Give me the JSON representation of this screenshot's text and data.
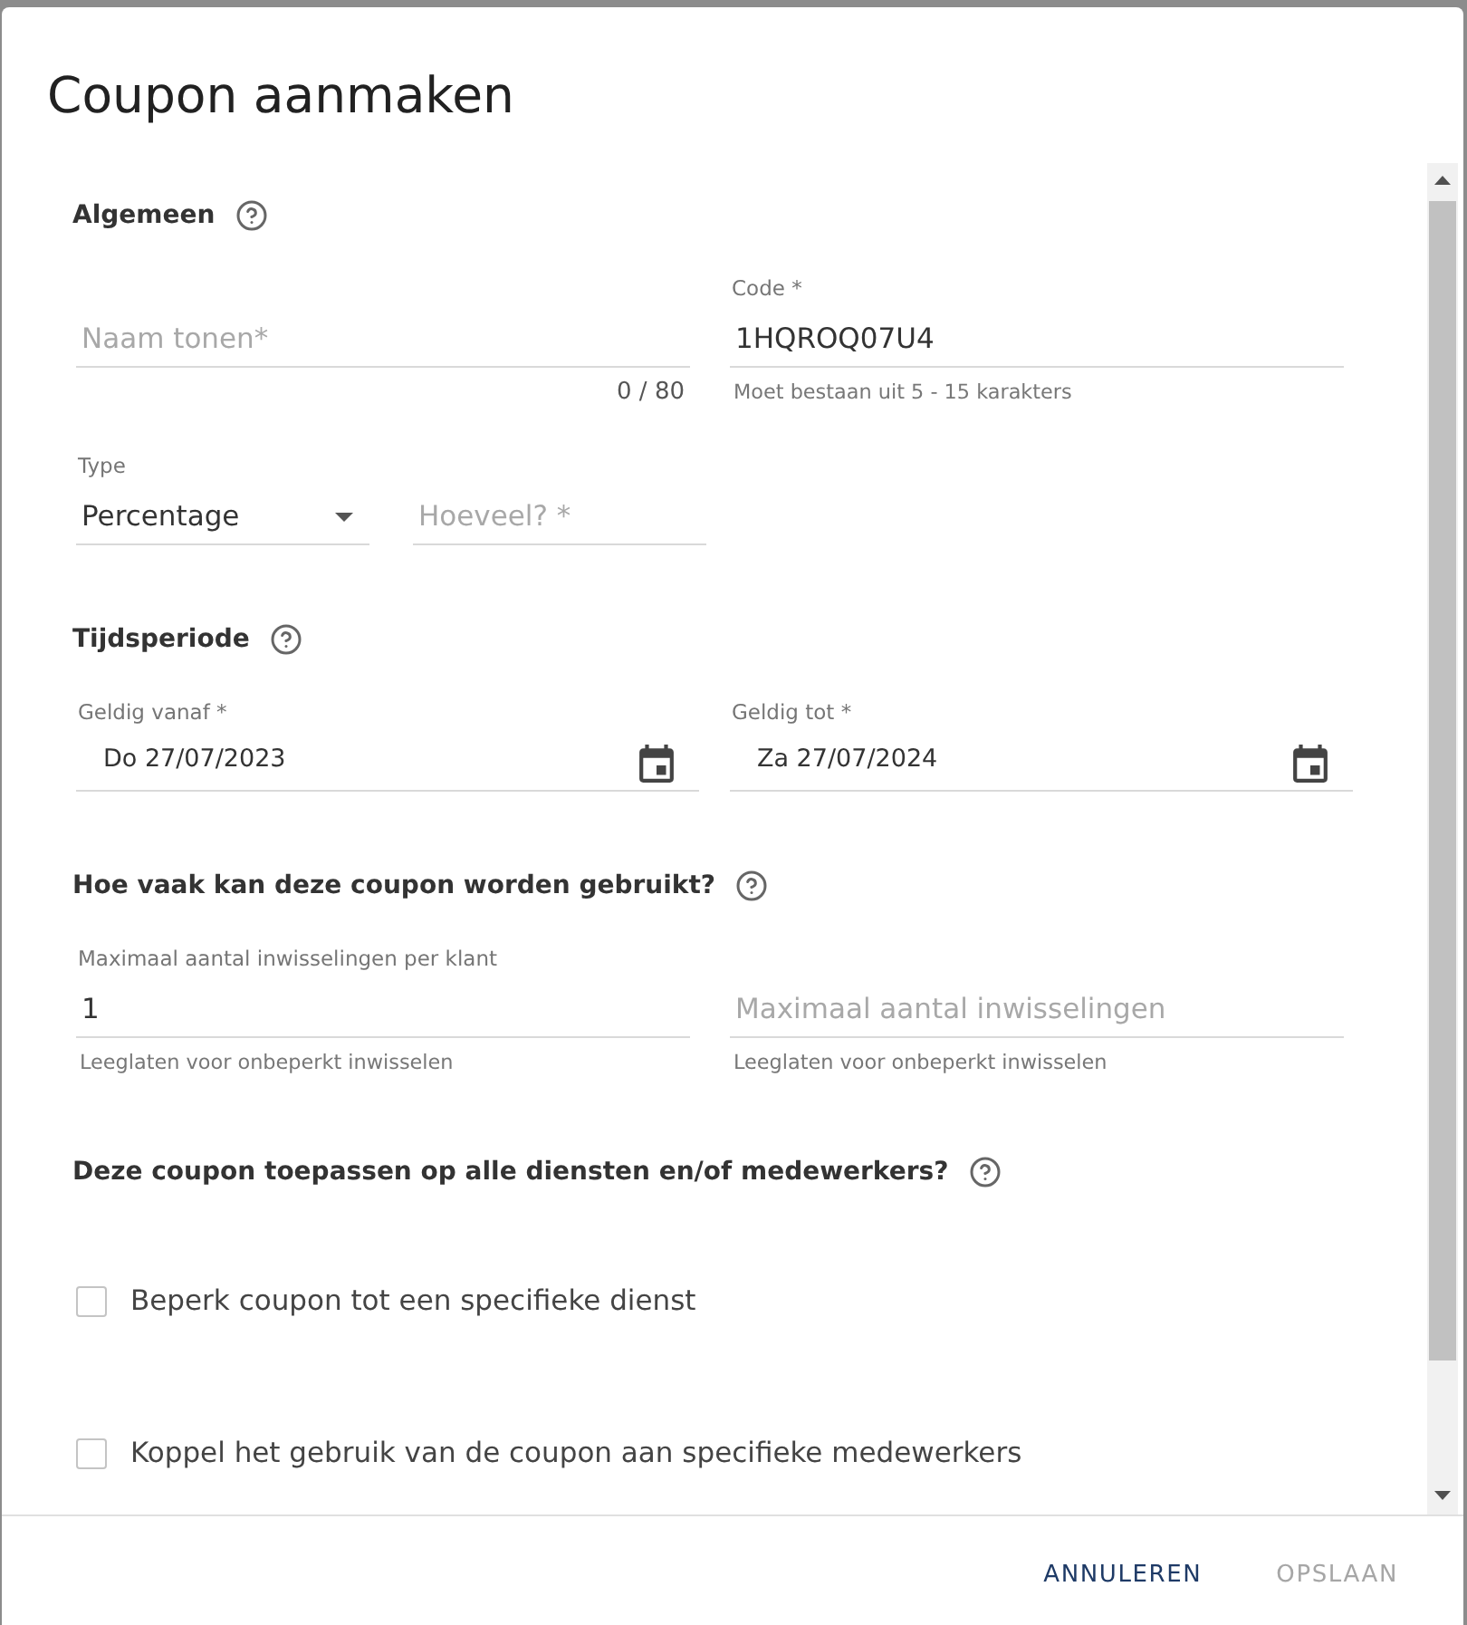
{
  "dialog": {
    "title": "Coupon aanmaken"
  },
  "general": {
    "heading": "Algemeen",
    "name_field": {
      "placeholder": "Naam tonen*",
      "counter": "0 / 80"
    },
    "code_field": {
      "label": "Code *",
      "value": "1HQROQ07U4",
      "helper": "Moet bestaan uit 5 - 15 karakters"
    },
    "type_select": {
      "label": "Type",
      "value": "Percentage"
    },
    "amount_field": {
      "placeholder": "Hoeveel? *"
    }
  },
  "period": {
    "heading": "Tijdsperiode",
    "fields": [
      {
        "label": "Geldig vanaf *",
        "value": "Do 27/07/2023"
      },
      {
        "label": "Geldig tot *",
        "value": "Za 27/07/2024"
      }
    ]
  },
  "usage": {
    "heading": "Hoe vaak kan deze coupon worden gebruikt?",
    "fields": [
      {
        "label": "Maximaal aantal inwisselingen per klant",
        "value": "1",
        "helper": "Leeglaten voor onbeperkt inwisselen"
      },
      {
        "placeholder": "Maximaal aantal inwisselingen",
        "helper": "Leeglaten voor onbeperkt inwisselen"
      }
    ]
  },
  "scope": {
    "heading": "Deze coupon toepassen op alle diensten en/of medewerkers?",
    "options": [
      {
        "label": "Beperk coupon tot een specifieke dienst",
        "checked": false
      },
      {
        "label": "Koppel het gebruik van de coupon aan specifieke medewerkers",
        "checked": false
      }
    ]
  },
  "footer": {
    "buttons": [
      {
        "label": "ANNULEREN",
        "disabled": false
      },
      {
        "label": "OPSLAAN",
        "disabled": true
      }
    ]
  }
}
